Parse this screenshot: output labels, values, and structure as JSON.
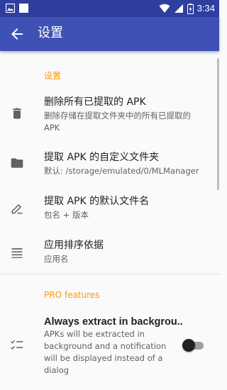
{
  "status_bar": {
    "time": "3:34"
  },
  "app_bar": {
    "title": "设置"
  },
  "sections": [
    {
      "category": "设置"
    },
    {
      "category": "PRO features"
    }
  ],
  "settings": [
    {
      "title": "删除所有已提取的 APK",
      "summary_line1": "删除存储在提取文件夹中的所有已提取的",
      "summary_line2": "APK",
      "icon": "trash-icon"
    },
    {
      "title": "提取 APK 的自定义文件夹",
      "summary": "默认: /storage/emulated/0/MLManager",
      "icon": "folder-icon"
    },
    {
      "title": "提取 APK 的默认文件名",
      "summary": "包名 + 版本",
      "icon": "edit-icon"
    },
    {
      "title": "应用排序依据",
      "summary": "应用名",
      "icon": "sort-icon"
    }
  ],
  "pro": {
    "title": "Always extract in backgrou..",
    "summary_lines": [
      "APKs will be extracted in",
      "background and a notification",
      "will be displayed instead of a",
      "dialog"
    ],
    "switch_on": false,
    "icon": "checklist-icon"
  },
  "colors": {
    "primary": "#3f51b5",
    "primary_dark": "#303f9f",
    "accent": "#ff9800"
  }
}
